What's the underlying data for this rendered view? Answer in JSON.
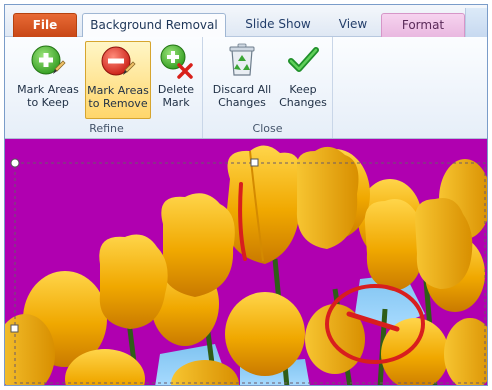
{
  "tabs": {
    "file": "File",
    "background_removal": "Background Removal",
    "slide_show": "Slide Show",
    "view": "View",
    "format": "Format"
  },
  "ribbon": {
    "refine_group": {
      "label": "Refine",
      "mark_keep": "Mark Areas\nto Keep",
      "mark_remove": "Mark Areas\nto Remove",
      "delete_mark": "Delete\nMark"
    },
    "close_group": {
      "label": "Close",
      "discard": "Discard All\nChanges",
      "keep": "Keep\nChanges"
    }
  },
  "colors": {
    "accent_file_tab": "#d4561f",
    "format_tab": "#e9b8e0",
    "background_removal_overlay": "#b000b0",
    "selected_button": "#ffd66b",
    "tulip_yellow": "#f4b400",
    "remove_mark": "#d81e1e"
  },
  "icons": {
    "mark_keep": "plus-circle-icon",
    "mark_remove": "minus-circle-icon",
    "delete_mark": "plus-x-icon",
    "discard": "recycle-bin-icon",
    "keep": "checkmark-icon"
  }
}
